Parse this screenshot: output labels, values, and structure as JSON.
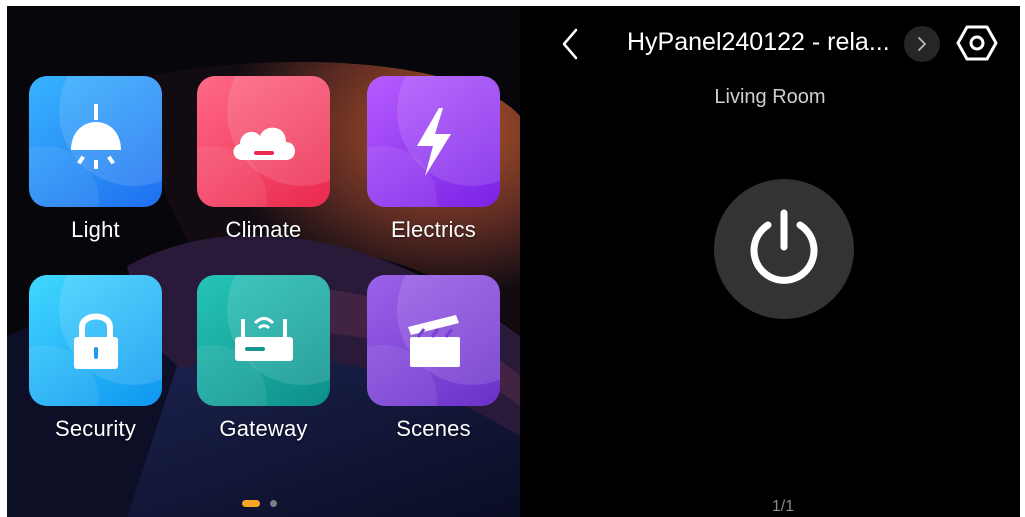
{
  "home": {
    "tiles": [
      {
        "label": "Light",
        "icon": "ceiling-lamp-icon",
        "color": "#2a8cf7"
      },
      {
        "label": "Climate",
        "icon": "cloud-icon",
        "color": "#f24563"
      },
      {
        "label": "Electrics",
        "icon": "lightning-bolt-icon",
        "color": "#9a3ef2"
      },
      {
        "label": "Security",
        "icon": "padlock-icon",
        "color": "#20b5f7"
      },
      {
        "label": "Gateway",
        "icon": "router-icon",
        "color": "#15a89f"
      },
      {
        "label": "Scenes",
        "icon": "clapperboard-icon",
        "color": "#8148da"
      }
    ],
    "pager": {
      "pages": 2,
      "active": 1,
      "active_color": "#f5a623"
    }
  },
  "device": {
    "title": "HyPanel240122 - rela...",
    "room": "Living Room",
    "power_icon": "power-icon",
    "page_indicator": "1/1"
  }
}
